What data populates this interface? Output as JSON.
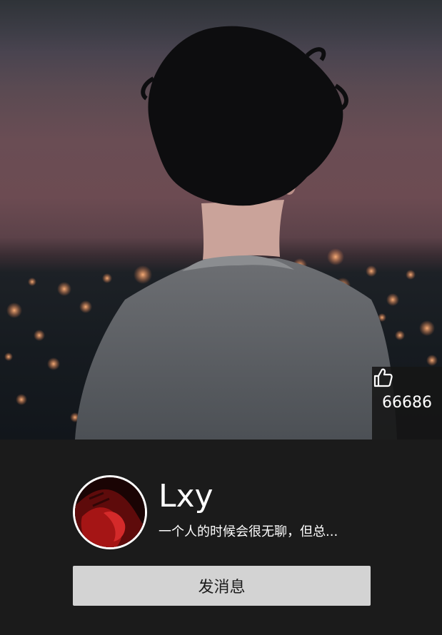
{
  "cover": {
    "icon": "cover-photo"
  },
  "likes": {
    "icon": "thumbs-up-icon",
    "count": "66686"
  },
  "profile": {
    "avatar_icon": "avatar",
    "name": "Lxy",
    "bio": "一个人的时候会很无聊，但总..."
  },
  "actions": {
    "message_label": "发消息"
  },
  "colors": {
    "background": "#1b1b1b",
    "button": "#d3d3d3",
    "text": "#ffffff"
  }
}
